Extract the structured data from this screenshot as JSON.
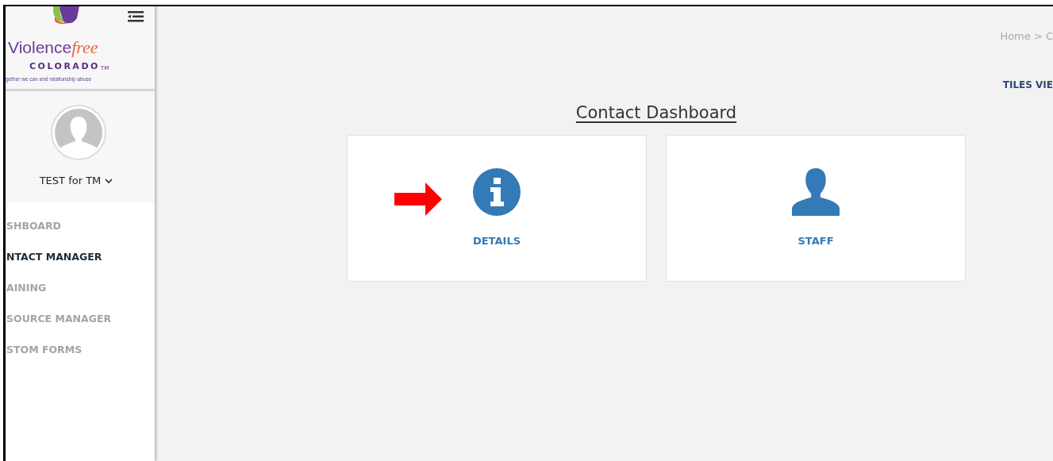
{
  "logo": {
    "word": "Violence",
    "script": "free",
    "state": "COLORADO",
    "mark": "TM",
    "tagline": "gether we can end relationship abuse"
  },
  "user": {
    "name": "TEST for TM"
  },
  "sidebar": {
    "items": [
      {
        "label": "SHBOARD",
        "selected": false
      },
      {
        "label": "NTACT MANAGER",
        "selected": true
      },
      {
        "label": "AINING",
        "selected": false
      },
      {
        "label": "SOURCE MANAGER",
        "selected": false
      },
      {
        "label": "STOM FORMS",
        "selected": false
      }
    ]
  },
  "breadcrumb": "Home > C",
  "view_link": "TILES VIE",
  "title": "Contact Dashboard",
  "tiles": [
    {
      "label": "DETAILS",
      "kind": "info"
    },
    {
      "label": "STAFF",
      "kind": "person"
    }
  ],
  "annotations": [
    {
      "kind": "arrow"
    }
  ]
}
